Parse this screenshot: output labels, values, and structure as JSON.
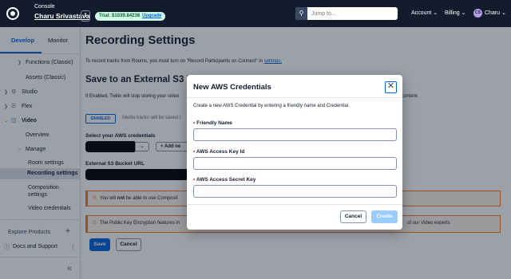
{
  "topbar": {
    "console_label": "Console",
    "account_name": "Charu Srivastava",
    "account_switch_glyph": "⇕",
    "trial_text": "Trial: $1039.84238",
    "upgrade_label": "Upgrade",
    "search_placeholder": "Jump to...",
    "search_icon": "search-icon",
    "nav_account": "Account ⌄",
    "nav_billing": "Billing ⌄",
    "user_initials": "CS",
    "user_name": "Charu ⌄"
  },
  "sidebar": {
    "tab_develop": "Develop",
    "tab_monitor": "Monitor",
    "functions_classic": "Functions (Classic)",
    "assets_classic": "Assets (Classic)",
    "studio": "Studio",
    "flex": "Flex",
    "video": "Video",
    "overview": "Overview",
    "manage": "Manage",
    "room_settings": "Room settings",
    "recording_settings": "Recording settings",
    "composition_settings_1": "Composition",
    "composition_settings_2": "settings",
    "video_credentials": "Video credentials",
    "explore_products": "Explore Products",
    "explore_plus": "+",
    "docs_support": "Docs and Support",
    "more_glyph": "⋮",
    "collapse_glyph": "«"
  },
  "main": {
    "title": "Recording Settings",
    "intro_text": "To record tracks from Rooms, you must turn on \"Record Participants on Connect\" in ",
    "intro_link": "settings.",
    "s3_heading": "Save to an External S3 Bu",
    "s3_desc_left": "If Enabled, Twilio will stop storing your video",
    "s3_desc_right": "content.",
    "toggle_label": "ENABLED",
    "media_text": "Media tracks will be saved t",
    "aws_cred_label": "Select your AWS credentials",
    "add_new_label": "+ Add ne",
    "bucket_label": "External S3 Bucket URL",
    "alert1_text_a": "You will ",
    "alert1_not": "not",
    "alert1_text_b": " be able to use Composit",
    "alert2_text": "The Public Key Encryption features in",
    "alert2_right": "of our Video experts",
    "save_label": "Save",
    "cancel_label": "Cancel"
  },
  "modal": {
    "title": "New AWS Credentials",
    "close_glyph": "✕",
    "description": "Create a new AWS Credential by entering a friendly name and Credential.",
    "field1_label": "Friendly Name",
    "field2_label": "AWS Access Key Id",
    "field3_label": "AWS Access Secret Key",
    "field1_value": "",
    "field2_value": "",
    "field3_value": "",
    "required_mark": "•",
    "cancel_label": "Cancel",
    "create_label": "Create"
  },
  "colors": {
    "topbar_bg": "#121c2d",
    "accent": "#0263e0",
    "warning": "#f47c22",
    "create_disabled": "#99cdff"
  }
}
